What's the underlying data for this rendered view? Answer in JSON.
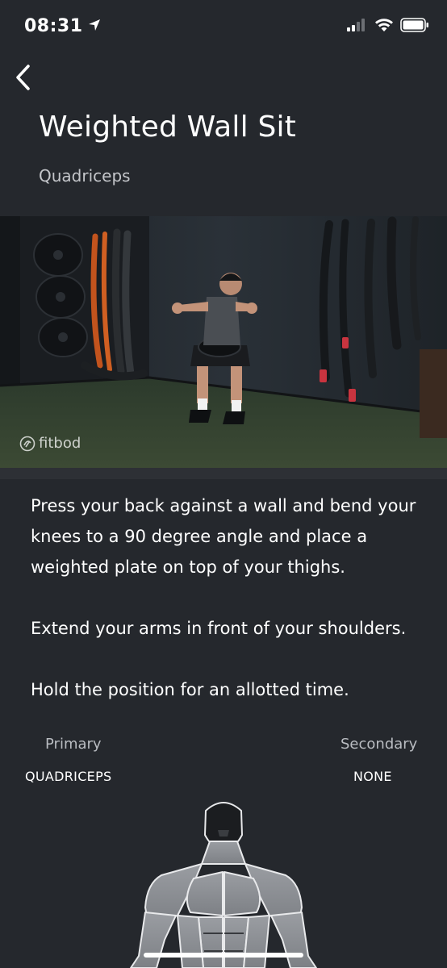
{
  "status_bar": {
    "time": "08:31",
    "location_icon": "location-arrow-icon",
    "signal_icon": "cellular-signal-icon",
    "wifi_icon": "wifi-icon",
    "battery_icon": "battery-icon"
  },
  "header": {
    "back_icon": "chevron-left-icon",
    "title": "Weighted Wall Sit",
    "subtitle": "Quadriceps"
  },
  "video": {
    "watermark": "fitbod"
  },
  "description": {
    "paragraphs": [
      "Press your back against a wall and bend your knees to a 90 degree angle and place a weighted plate on top of your thighs.",
      "Extend your arms in front of your shoulders.",
      "Hold the position for an allotted time."
    ]
  },
  "muscles": {
    "primary_label": "Primary",
    "primary_value": "QUADRICEPS",
    "secondary_label": "Secondary",
    "secondary_value": "NONE"
  },
  "colors": {
    "background": "#25282d",
    "text": "#ffffff",
    "muted_text": "#b9bcc1"
  }
}
